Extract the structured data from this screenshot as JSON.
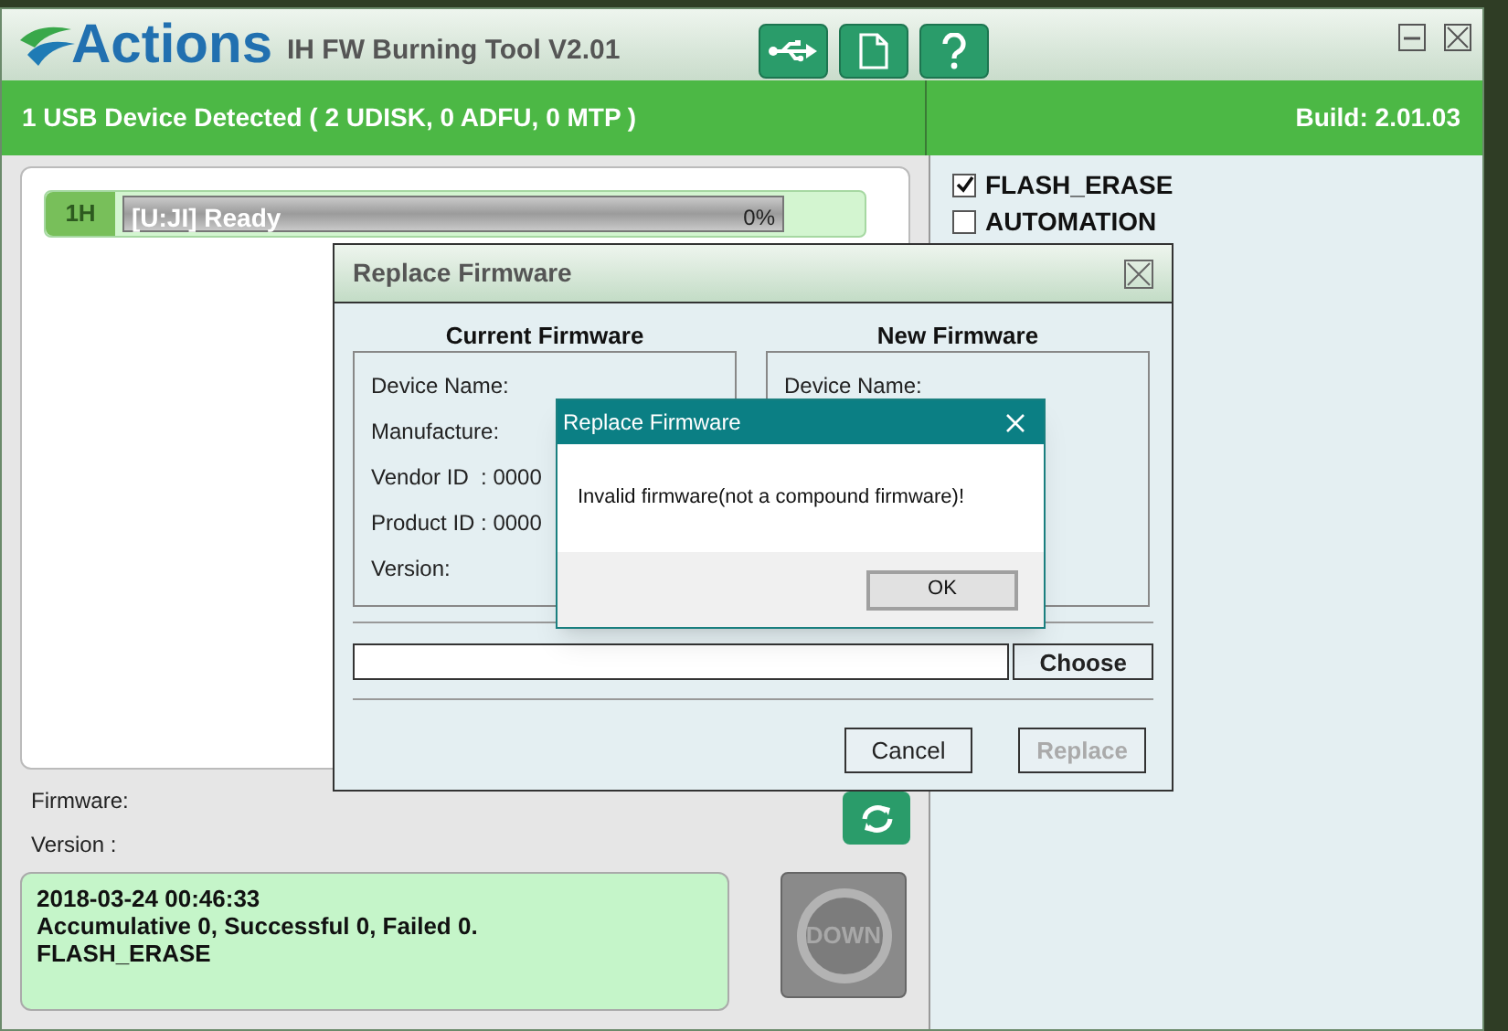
{
  "app": {
    "logo": "Actions",
    "title": "IH FW Burning Tool V2.01"
  },
  "status_bar": {
    "devices": "1 USB Device Detected ( 2 UDISK, 0 ADFU, 0 MTP )",
    "build": "Build: 2.01.03"
  },
  "ports": [
    {
      "label": "1H",
      "status": "[U:JI] Ready",
      "percent": "0%",
      "level": 0
    }
  ],
  "options": [
    {
      "label": "FLASH_ERASE",
      "checked": true
    },
    {
      "label": "AUTOMATION",
      "checked": false
    }
  ],
  "firmware_info": {
    "firmware": "Firmware:",
    "version": "Version :"
  },
  "log": [
    "2018-03-24 00:46:33",
    "Accumulative 0, Successful 0, Failed 0.",
    "FLASH_ERASE"
  ],
  "down_button": {
    "label": "DOWN",
    "disabled": true
  },
  "dialog": {
    "title": "Replace Firmware",
    "current": {
      "heading": "Current Firmware",
      "fields": [
        "Device Name:",
        "Manufacture:",
        "Vendor ID  : 0000",
        "Product ID : 0000",
        "Version:"
      ]
    },
    "new": {
      "heading": "New Firmware",
      "fields": [
        "Device Name:"
      ]
    },
    "choose": "Choose",
    "cancel": "Cancel",
    "replace": {
      "label": "Replace",
      "disabled": true
    }
  },
  "message_box": {
    "title": "Replace Firmware",
    "message": "Invalid firmware(not a compound firmware)!",
    "ok": "OK"
  }
}
